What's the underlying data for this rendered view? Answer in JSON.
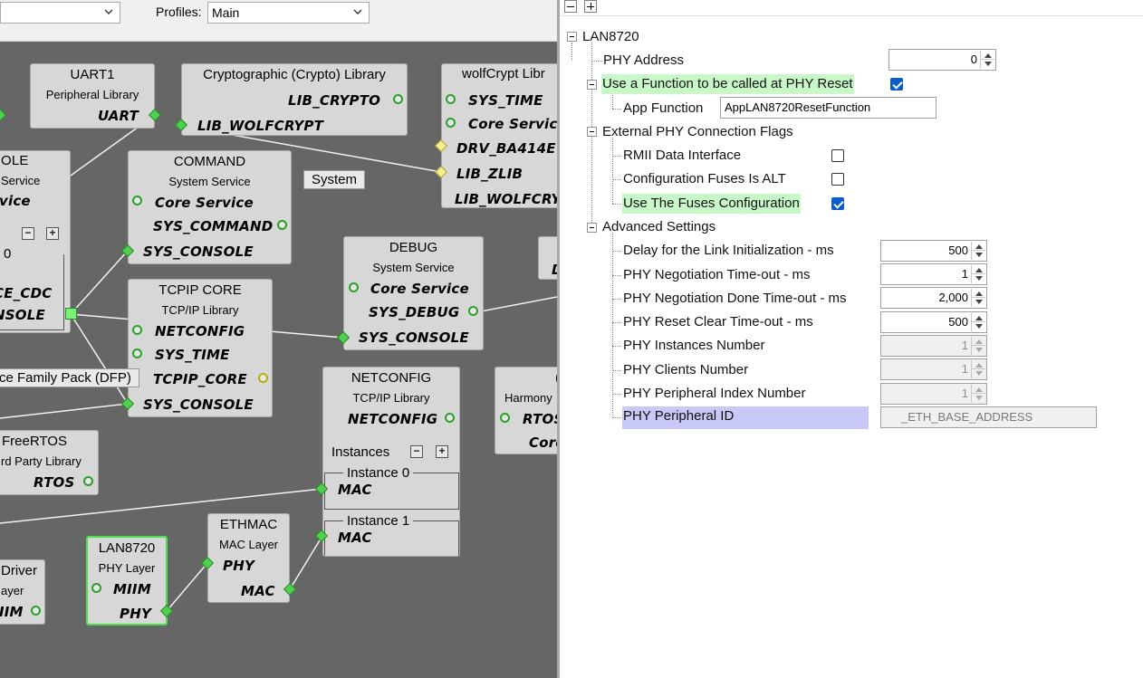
{
  "toolbar": {
    "combo1_value": "",
    "profiles_label": "Profiles:",
    "profiles_value": "Main"
  },
  "canvas": {
    "uart1": {
      "title": "UART1",
      "subtitle": "Peripheral Library",
      "port_uart": "UART"
    },
    "crypto": {
      "title": "Cryptographic (Crypto) Library",
      "port_lib_crypto": "LIB_CRYPTO",
      "port_lib_wolfcrypt": "LIB_WOLFCRYPT"
    },
    "wolfcrypt": {
      "title": "wolfCrypt Libr",
      "port_sys_time": "SYS_TIME",
      "port_core_service": "Core Service",
      "port_drv": "DRV_BA414E",
      "port_lib_zlib": "LIB_ZLIB",
      "port_lib_wolfcry": "LIB_WOLFCRY"
    },
    "console": {
      "title": "OLE",
      "subtitle": "Service",
      "port_service": "vice",
      "instance_count": "0",
      "port_cdc": "CE_CDC",
      "port_console": "NSOLE"
    },
    "command": {
      "title": "COMMAND",
      "subtitle": "System Service",
      "port_core": "Core Service",
      "port_sys_command": "SYS_COMMAND",
      "port_sys_console": "SYS_CONSOLE"
    },
    "system_chip": "System",
    "debug": {
      "title": "DEBUG",
      "subtitle": "System Service",
      "port_core": "Core Service",
      "port_sys_debug": "SYS_DEBUG",
      "port_sys_console": "SYS_CONSOLE"
    },
    "tcpip": {
      "title": "TCPIP CORE",
      "subtitle": "TCP/IP Library",
      "port_netconfig": "NETCONFIG",
      "port_sys_time": "SYS_TIME",
      "port_tcpip_core": "TCPIP_CORE",
      "port_sys_console": "SYS_CONSOLE"
    },
    "dfp_chip": "ce Family Pack (DFP)",
    "netconfig": {
      "title": "NETCONFIG",
      "subtitle": "TCP/IP Library",
      "port_netconfig": "NETCONFIG",
      "instances_label": "Instances",
      "instance0": "Instance 0",
      "instance0_port": "MAC",
      "instance1": "Instance 1",
      "instance1_port": "MAC"
    },
    "harmony": {
      "title": "(",
      "subtitle": "Harmony",
      "port_rtos": "RTOS",
      "port_core": "Core"
    },
    "freertos": {
      "title": "FreeRTOS",
      "subtitle": "rd Party Library",
      "port_rtos": "RTOS"
    },
    "lan8720": {
      "title": "LAN8720",
      "subtitle": "PHY Layer",
      "port_miim": "MIIM",
      "port_phy": "PHY"
    },
    "ethmac": {
      "title": "ETHMAC",
      "subtitle": "MAC Layer",
      "port_phy": "PHY",
      "port_mac": "MAC"
    },
    "driver": {
      "title": "Driver",
      "subtitle": "ayer",
      "port_iim": "IIM"
    },
    "right_partial": {
      "port": "D"
    }
  },
  "properties": {
    "root": "LAN8720",
    "phy_address": {
      "label": "PHY Address",
      "value": "0"
    },
    "use_function": {
      "label": "Use a Function to be called at PHY Reset",
      "checked": true
    },
    "app_function": {
      "label": "App Function",
      "value": "AppLAN8720ResetFunction"
    },
    "ext_flags": {
      "label": "External PHY Connection Flags"
    },
    "rmii": {
      "label": "RMII Data Interface",
      "checked": false
    },
    "config_fuses_alt": {
      "label": "Configuration Fuses Is ALT",
      "checked": false
    },
    "use_fuses": {
      "label": "Use The Fuses Configuration",
      "checked": true
    },
    "advanced": {
      "label": "Advanced Settings"
    },
    "delay_link": {
      "label": "Delay for the Link Initialization - ms",
      "value": "500"
    },
    "neg_timeout": {
      "label": "PHY Negotiation Time-out - ms",
      "value": "1"
    },
    "neg_done_timeout": {
      "label": "PHY Negotiation Done Time-out - ms",
      "value": "2,000"
    },
    "reset_clear_timeout": {
      "label": "PHY Reset Clear Time-out - ms",
      "value": "500"
    },
    "instances_number": {
      "label": "PHY Instances Number",
      "value": "1"
    },
    "clients_number": {
      "label": "PHY Clients Number",
      "value": "1"
    },
    "peripheral_index": {
      "label": "PHY Peripheral Index Number",
      "value": "1"
    },
    "peripheral_id": {
      "label": "PHY Peripheral ID",
      "value": "_ETH_BASE_ADDRESS"
    }
  }
}
